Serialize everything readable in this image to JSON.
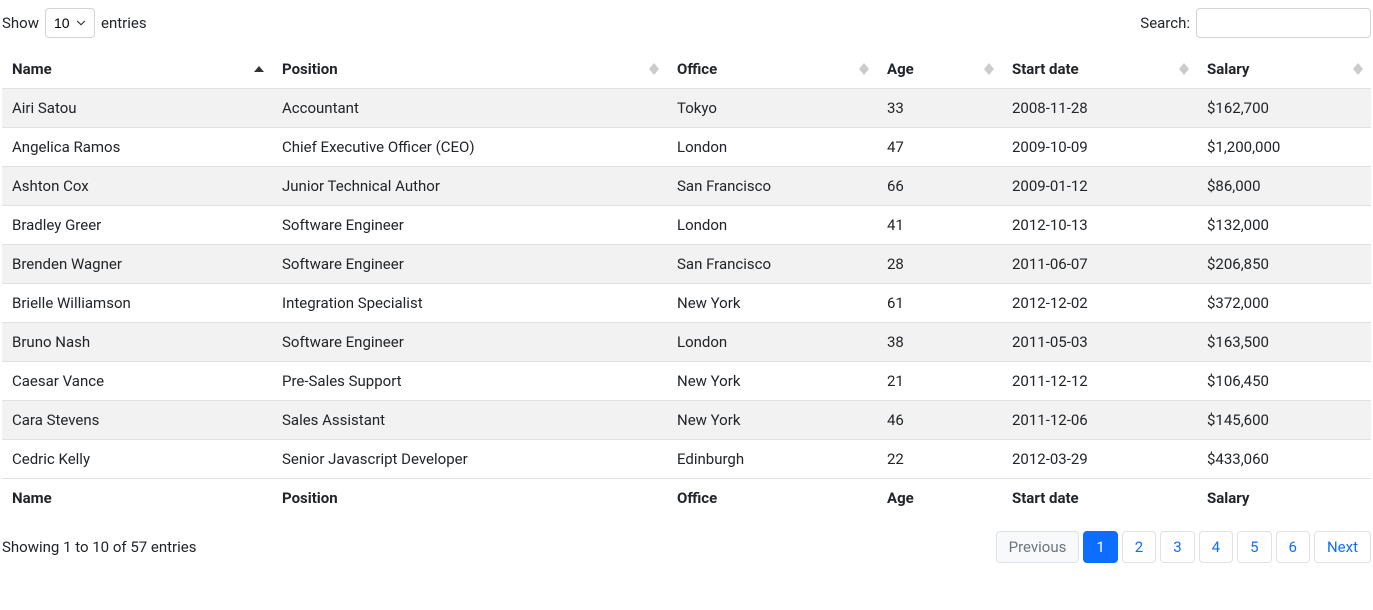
{
  "length": {
    "show_label": "Show",
    "entries_label": "entries",
    "selected": "10"
  },
  "search": {
    "label": "Search:",
    "value": ""
  },
  "columns": [
    {
      "key": "name",
      "label": "Name",
      "sorted": "asc"
    },
    {
      "key": "position",
      "label": "Position",
      "sorted": "both"
    },
    {
      "key": "office",
      "label": "Office",
      "sorted": "both"
    },
    {
      "key": "age",
      "label": "Age",
      "sorted": "both"
    },
    {
      "key": "start_date",
      "label": "Start date",
      "sorted": "both"
    },
    {
      "key": "salary",
      "label": "Salary",
      "sorted": "both"
    }
  ],
  "rows": [
    {
      "name": "Airi Satou",
      "position": "Accountant",
      "office": "Tokyo",
      "age": "33",
      "start_date": "2008-11-28",
      "salary": "$162,700"
    },
    {
      "name": "Angelica Ramos",
      "position": "Chief Executive Officer (CEO)",
      "office": "London",
      "age": "47",
      "start_date": "2009-10-09",
      "salary": "$1,200,000"
    },
    {
      "name": "Ashton Cox",
      "position": "Junior Technical Author",
      "office": "San Francisco",
      "age": "66",
      "start_date": "2009-01-12",
      "salary": "$86,000"
    },
    {
      "name": "Bradley Greer",
      "position": "Software Engineer",
      "office": "London",
      "age": "41",
      "start_date": "2012-10-13",
      "salary": "$132,000"
    },
    {
      "name": "Brenden Wagner",
      "position": "Software Engineer",
      "office": "San Francisco",
      "age": "28",
      "start_date": "2011-06-07",
      "salary": "$206,850"
    },
    {
      "name": "Brielle Williamson",
      "position": "Integration Specialist",
      "office": "New York",
      "age": "61",
      "start_date": "2012-12-02",
      "salary": "$372,000"
    },
    {
      "name": "Bruno Nash",
      "position": "Software Engineer",
      "office": "London",
      "age": "38",
      "start_date": "2011-05-03",
      "salary": "$163,500"
    },
    {
      "name": "Caesar Vance",
      "position": "Pre-Sales Support",
      "office": "New York",
      "age": "21",
      "start_date": "2011-12-12",
      "salary": "$106,450"
    },
    {
      "name": "Cara Stevens",
      "position": "Sales Assistant",
      "office": "New York",
      "age": "46",
      "start_date": "2011-12-06",
      "salary": "$145,600"
    },
    {
      "name": "Cedric Kelly",
      "position": "Senior Javascript Developer",
      "office": "Edinburgh",
      "age": "22",
      "start_date": "2012-03-29",
      "salary": "$433,060"
    }
  ],
  "info": "Showing 1 to 10 of 57 entries",
  "pagination": {
    "previous": "Previous",
    "next": "Next",
    "pages": [
      "1",
      "2",
      "3",
      "4",
      "5",
      "6"
    ],
    "active": "1",
    "prev_disabled": true,
    "next_disabled": false
  }
}
